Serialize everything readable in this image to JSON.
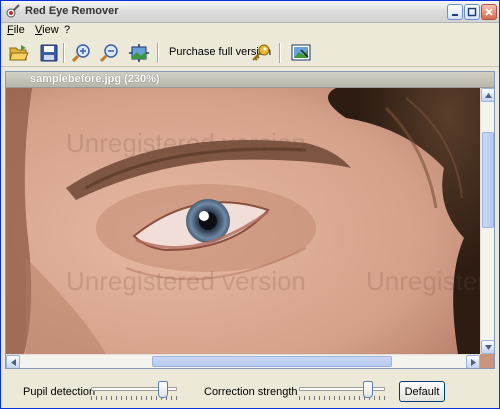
{
  "window": {
    "title": "Red Eye Remover"
  },
  "menu": {
    "items": [
      {
        "label": "File",
        "accel": "F",
        "rest": "ile"
      },
      {
        "label": "View",
        "accel": "V",
        "rest": "iew"
      },
      {
        "label": "?",
        "accel": "",
        "rest": "?"
      }
    ]
  },
  "toolbar": {
    "open_icon": "open-folder-icon",
    "save_icon": "save-disk-icon",
    "zoom_in_icon": "zoom-in-icon",
    "zoom_out_icon": "zoom-out-icon",
    "fit_icon": "fit-to-window-icon",
    "purchase_label": "Purchase full version",
    "key_icon": "key-icon",
    "preview_icon": "preview-icon"
  },
  "image": {
    "title": "samplebefore.jpg (230%)",
    "watermark": "Unregistered version"
  },
  "controls": {
    "pupil_label": "Pupil detection",
    "pupil_value": 0.88,
    "strength_label": "Correction strength",
    "strength_value": 0.84,
    "default_label": "Default"
  },
  "colors": {
    "titlebar": "#d8d8d8",
    "accent": "#0831d9",
    "skin": "#c9957c"
  }
}
